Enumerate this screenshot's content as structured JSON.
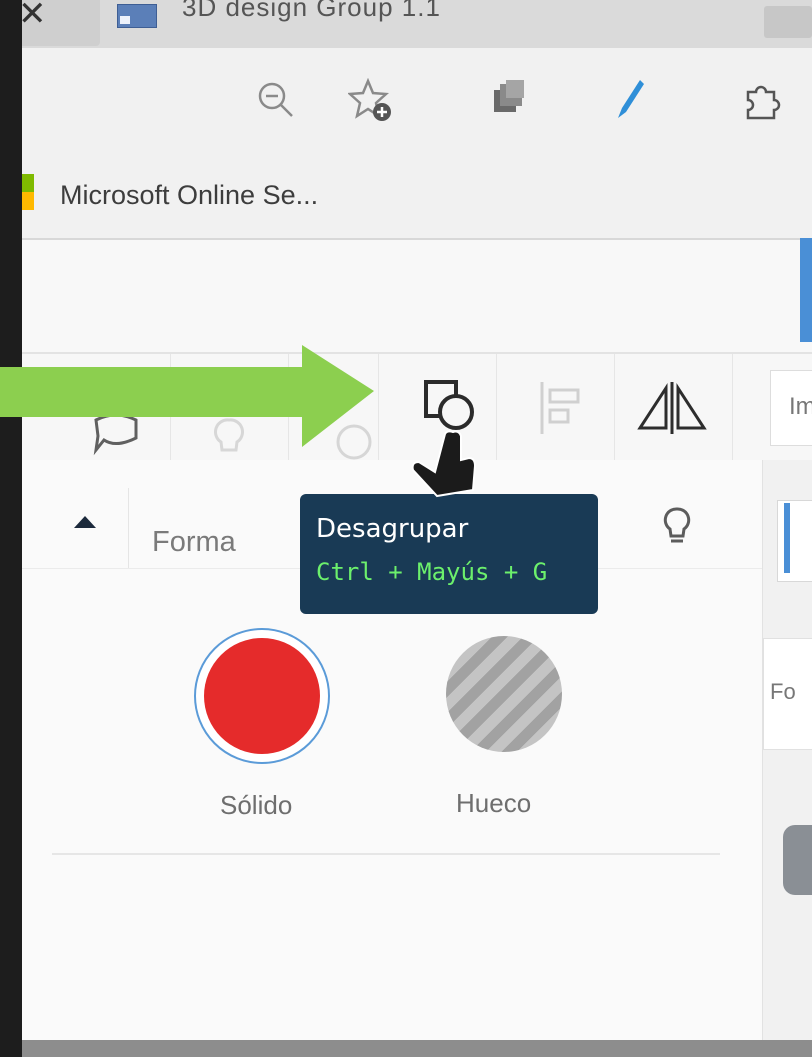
{
  "browser": {
    "close_glyph": "✕",
    "tab_title": "3D design Group 1.1",
    "favorites": [
      {
        "label": "Microsoft Online Se..."
      }
    ],
    "toolbar_icons": [
      "zoom-out-icon",
      "add-favorite-icon",
      "collections-icon",
      "pen-icon",
      "extensions-icon"
    ]
  },
  "app": {
    "tools": [
      "comment-icon",
      "lightbulb-icon",
      "group-icon",
      "ungroup-icon",
      "align-icon",
      "mirror-icon"
    ],
    "import_label": "Im",
    "shape_panel": {
      "title": "Forma",
      "options": [
        {
          "label": "Sólido",
          "color": "#e52b2b",
          "selected": true
        },
        {
          "label": "Hueco",
          "color": "#b3b3b3",
          "selected": false
        }
      ]
    },
    "side_field_label": "Fo",
    "tooltip": {
      "title": "Desagrupar",
      "shortcut": "Ctrl + Mayús + G"
    }
  },
  "colors": {
    "annotation_arrow": "#8ccf4f",
    "tooltip_bg": "#193a55",
    "shortcut_text": "#6cf06c",
    "accent_blue": "#4a8fd6"
  }
}
